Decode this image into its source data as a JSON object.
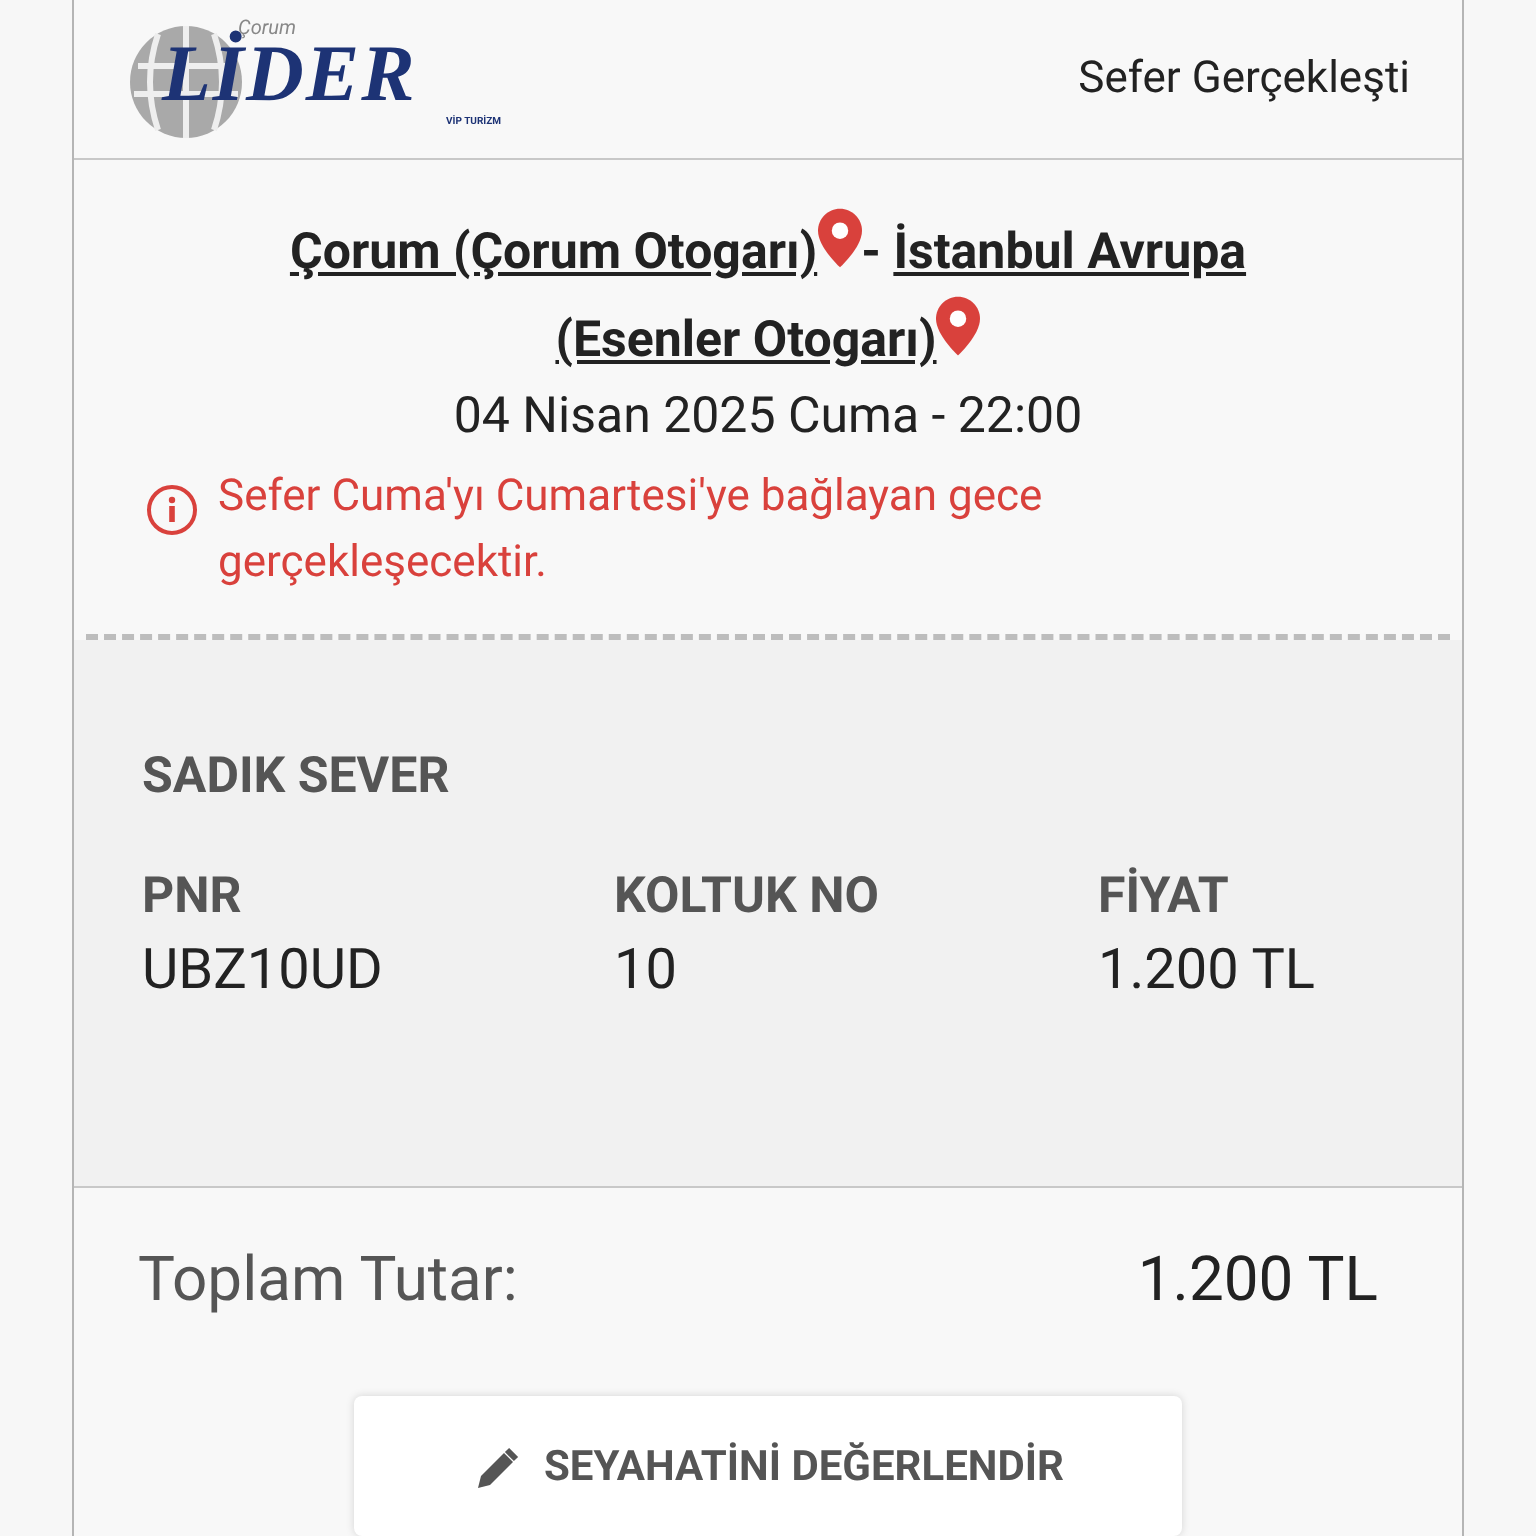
{
  "header": {
    "logo": {
      "top": "Çorum",
      "main": "LİDER",
      "sub": "VİP TURİZM"
    },
    "status": "Sefer Gerçekleşti"
  },
  "route": {
    "from": "Çorum (Çorum Otogarı)",
    "separator": "- ",
    "to_lines": [
      "İstanbul Avrupa",
      "(Esenler Otogarı)"
    ],
    "datetime": "04 Nisan 2025 Cuma - 22:00",
    "notice": "Sefer Cuma'yı Cumartesi'ye bağlayan gece gerçekleşecektir."
  },
  "passenger": {
    "name": "SADIK SEVER",
    "fields": [
      {
        "label": "PNR",
        "value": "UBZ10UD"
      },
      {
        "label": "KOLTUK NO",
        "value": "10"
      },
      {
        "label": "FİYAT",
        "value": "1.200 TL"
      }
    ]
  },
  "total": {
    "label": "Toplam Tutar:",
    "value": "1.200 TL"
  },
  "review_button": "SEYAHATİNİ DEĞERLENDİR"
}
